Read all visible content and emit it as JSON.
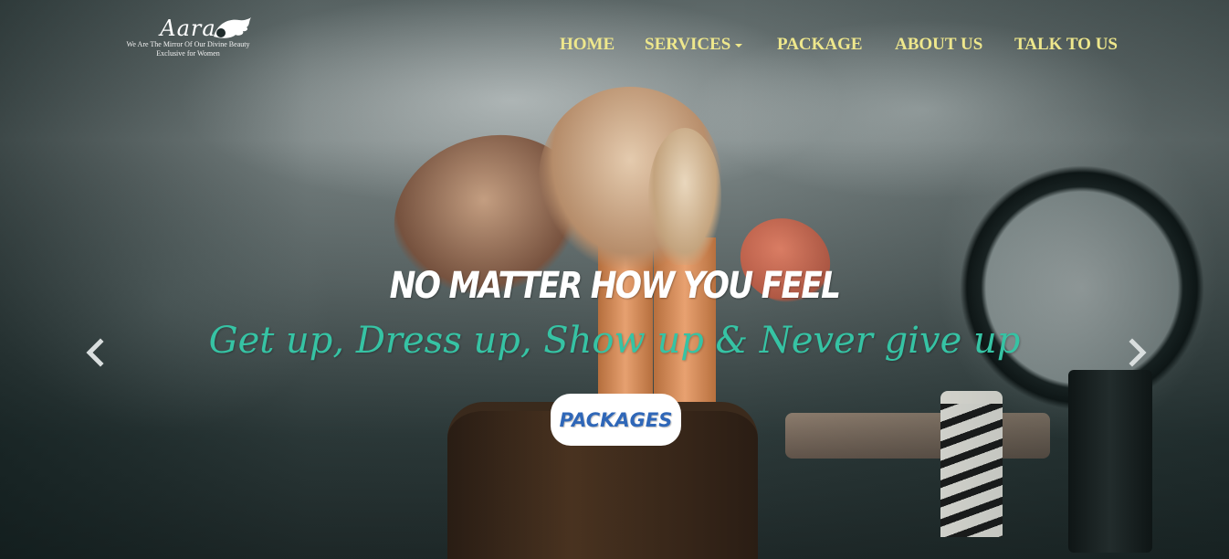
{
  "brand": {
    "logo_script": "Aara",
    "tagline": "We Are The Mirror Of Our Divine Beauty",
    "subtitle": "Exclusive for Women"
  },
  "nav": {
    "items": [
      {
        "label": "HOME"
      },
      {
        "label": "SERVICES",
        "has_dropdown": true
      },
      {
        "label": "PACKAGE"
      },
      {
        "label": "ABOUT US"
      },
      {
        "label": "TALK TO US"
      }
    ],
    "color": "#eee78c"
  },
  "carousel": {
    "headline": "NO MATTER HOW YOU FEEL",
    "tagline": "Get up, Dress up, Show up & Never give up",
    "cta_label": "PACKAGES",
    "prev_icon": "chevron-left-icon",
    "next_icon": "chevron-right-icon"
  },
  "colors": {
    "headline": "#ffffff",
    "tagline": "#36c3a4",
    "cta_text": "#2f67b8",
    "cta_bg": "#ffffff"
  }
}
